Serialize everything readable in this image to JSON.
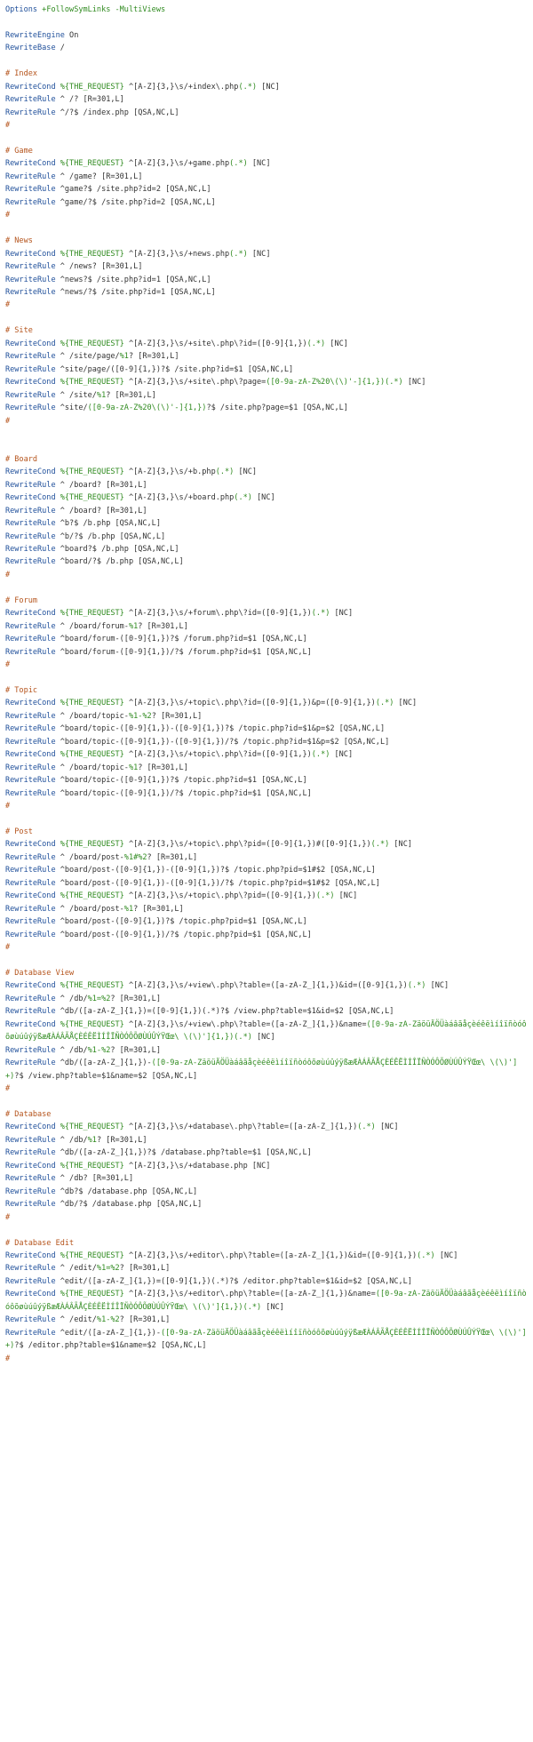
{
  "document": {
    "lines": [
      [
        [
          "kw",
          "Options"
        ],
        [
          "vr",
          " +FollowSymLinks -MultiViews"
        ]
      ],
      [],
      [
        [
          "kw",
          "RewriteEngine"
        ],
        [
          "fl",
          " On"
        ]
      ],
      [
        [
          "kw",
          "RewriteBase"
        ],
        [
          "fl",
          " /"
        ]
      ],
      [],
      [
        [
          "cm",
          "# Index"
        ]
      ],
      [
        [
          "kw",
          "RewriteCond"
        ],
        [
          "vr",
          " %{THE_REQUEST}"
        ],
        [
          "fl",
          " ^[A-Z]{3,}\\s/+index\\.php"
        ],
        [
          "vr",
          "(.*)"
        ],
        [
          "fl",
          " [NC]"
        ]
      ],
      [
        [
          "kw",
          "RewriteRule"
        ],
        [
          "fl",
          " ^ /? [R=301,L]"
        ]
      ],
      [
        [
          "kw",
          "RewriteRule"
        ],
        [
          "fl",
          " ^/?$ /index.php [QSA,NC,L]"
        ]
      ],
      [
        [
          "cm",
          "#"
        ]
      ],
      [],
      [
        [
          "cm",
          "# Game"
        ]
      ],
      [
        [
          "kw",
          "RewriteCond"
        ],
        [
          "vr",
          " %{THE_REQUEST}"
        ],
        [
          "fl",
          " ^[A-Z]{3,}\\s/+game.php"
        ],
        [
          "vr",
          "(.*)"
        ],
        [
          "fl",
          " [NC]"
        ]
      ],
      [
        [
          "kw",
          "RewriteRule"
        ],
        [
          "fl",
          " ^ /game? [R=301,L]"
        ]
      ],
      [
        [
          "kw",
          "RewriteRule"
        ],
        [
          "fl",
          " ^game?$ /site.php?id=2 [QSA,NC,L]"
        ]
      ],
      [
        [
          "kw",
          "RewriteRule"
        ],
        [
          "fl",
          " ^game/?$ /site.php?id=2 [QSA,NC,L]"
        ]
      ],
      [
        [
          "cm",
          "#"
        ]
      ],
      [],
      [
        [
          "cm",
          "# News"
        ]
      ],
      [
        [
          "kw",
          "RewriteCond"
        ],
        [
          "vr",
          " %{THE_REQUEST}"
        ],
        [
          "fl",
          " ^[A-Z]{3,}\\s/+news.php"
        ],
        [
          "vr",
          "(.*)"
        ],
        [
          "fl",
          " [NC]"
        ]
      ],
      [
        [
          "kw",
          "RewriteRule"
        ],
        [
          "fl",
          " ^ /news? [R=301,L]"
        ]
      ],
      [
        [
          "kw",
          "RewriteRule"
        ],
        [
          "fl",
          " ^news?$ /site.php?id=1 [QSA,NC,L]"
        ]
      ],
      [
        [
          "kw",
          "RewriteRule"
        ],
        [
          "fl",
          " ^news/?$ /site.php?id=1 [QSA,NC,L]"
        ]
      ],
      [
        [
          "cm",
          "#"
        ]
      ],
      [],
      [
        [
          "cm",
          "# Site"
        ]
      ],
      [
        [
          "kw",
          "RewriteCond"
        ],
        [
          "vr",
          " %{THE_REQUEST}"
        ],
        [
          "fl",
          " ^[A-Z]{3,}\\s/+site\\.php\\?id=([0-9]{1,})"
        ],
        [
          "vr",
          "(.*)"
        ],
        [
          "fl",
          " [NC]"
        ]
      ],
      [
        [
          "kw",
          "RewriteRule"
        ],
        [
          "fl",
          " ^ /site/page/"
        ],
        [
          "vr",
          "%1"
        ],
        [
          "fl",
          "? [R=301,L]"
        ]
      ],
      [
        [
          "kw",
          "RewriteRule"
        ],
        [
          "fl",
          " ^site/page/([0-9]{1,})?$ /site.php?id=$1 [QSA,NC,L]"
        ]
      ],
      [
        [
          "kw",
          "RewriteCond"
        ],
        [
          "vr",
          " %{THE_REQUEST}"
        ],
        [
          "fl",
          " ^[A-Z]{3,}\\s/+site\\.php\\?page="
        ],
        [
          "vr",
          "([0-9a-zA-Z%20\\(\\)'-]{1,})(.*)"
        ],
        [
          "fl",
          " [NC]"
        ]
      ],
      [
        [
          "kw",
          "RewriteRule"
        ],
        [
          "fl",
          " ^ /site/"
        ],
        [
          "vr",
          "%1"
        ],
        [
          "fl",
          "? [R=301,L]"
        ]
      ],
      [
        [
          "kw",
          "RewriteRule"
        ],
        [
          "fl",
          " ^site/"
        ],
        [
          "vr",
          "([0-9a-zA-Z%20\\(\\)'-]{1,})"
        ],
        [
          "fl",
          "?$ /site.php?page=$1 [QSA,NC,L]"
        ]
      ],
      [
        [
          "cm",
          "#"
        ]
      ],
      [],
      [],
      [
        [
          "cm",
          "# Board"
        ]
      ],
      [
        [
          "kw",
          "RewriteCond"
        ],
        [
          "vr",
          " %{THE_REQUEST}"
        ],
        [
          "fl",
          " ^[A-Z]{3,}\\s/+b.php"
        ],
        [
          "vr",
          "(.*)"
        ],
        [
          "fl",
          " [NC]"
        ]
      ],
      [
        [
          "kw",
          "RewriteRule"
        ],
        [
          "fl",
          " ^ /board? [R=301,L]"
        ]
      ],
      [
        [
          "kw",
          "RewriteCond"
        ],
        [
          "vr",
          " %{THE_REQUEST}"
        ],
        [
          "fl",
          " ^[A-Z]{3,}\\s/+board.php"
        ],
        [
          "vr",
          "(.*)"
        ],
        [
          "fl",
          " [NC]"
        ]
      ],
      [
        [
          "kw",
          "RewriteRule"
        ],
        [
          "fl",
          " ^ /board? [R=301,L]"
        ]
      ],
      [
        [
          "kw",
          "RewriteRule"
        ],
        [
          "fl",
          " ^b?$ /b.php [QSA,NC,L]"
        ]
      ],
      [
        [
          "kw",
          "RewriteRule"
        ],
        [
          "fl",
          " ^b/?$ /b.php [QSA,NC,L]"
        ]
      ],
      [
        [
          "kw",
          "RewriteRule"
        ],
        [
          "fl",
          " ^board?$ /b.php [QSA,NC,L]"
        ]
      ],
      [
        [
          "kw",
          "RewriteRule"
        ],
        [
          "fl",
          " ^board/?$ /b.php [QSA,NC,L]"
        ]
      ],
      [
        [
          "cm",
          "#"
        ]
      ],
      [],
      [
        [
          "cm",
          "# Forum"
        ]
      ],
      [
        [
          "kw",
          "RewriteCond"
        ],
        [
          "vr",
          " %{THE_REQUEST}"
        ],
        [
          "fl",
          " ^[A-Z]{3,}\\s/+forum\\.php\\?id=([0-9]{1,})"
        ],
        [
          "vr",
          "(.*)"
        ],
        [
          "fl",
          " [NC]"
        ]
      ],
      [
        [
          "kw",
          "RewriteRule"
        ],
        [
          "fl",
          " ^ /board/forum-"
        ],
        [
          "vr",
          "%1"
        ],
        [
          "fl",
          "? [R=301,L]"
        ]
      ],
      [
        [
          "kw",
          "RewriteRule"
        ],
        [
          "fl",
          " ^board/forum-([0-9]{1,})?$ /forum.php?id=$1 [QSA,NC,L]"
        ]
      ],
      [
        [
          "kw",
          "RewriteRule"
        ],
        [
          "fl",
          " ^board/forum-([0-9]{1,})/?$ /forum.php?id=$1 [QSA,NC,L]"
        ]
      ],
      [
        [
          "cm",
          "#"
        ]
      ],
      [],
      [
        [
          "cm",
          "# Topic"
        ]
      ],
      [
        [
          "kw",
          "RewriteCond"
        ],
        [
          "vr",
          " %{THE_REQUEST}"
        ],
        [
          "fl",
          " ^[A-Z]{3,}\\s/+topic\\.php\\?id=([0-9]{1,})&p=([0-9]{1,})"
        ],
        [
          "vr",
          "(.*)"
        ],
        [
          "fl",
          " [NC]"
        ]
      ],
      [
        [
          "kw",
          "RewriteRule"
        ],
        [
          "fl",
          " ^ /board/topic-"
        ],
        [
          "vr",
          "%1-%2"
        ],
        [
          "fl",
          "? [R=301,L]"
        ]
      ],
      [
        [
          "kw",
          "RewriteRule"
        ],
        [
          "fl",
          " ^board/topic-([0-9]{1,})-([0-9]{1,})?$ /topic.php?id=$1&p=$2 [QSA,NC,L]"
        ]
      ],
      [
        [
          "kw",
          "RewriteRule"
        ],
        [
          "fl",
          " ^board/topic-([0-9]{1,})-([0-9]{1,})/?$ /topic.php?id=$1&p=$2 [QSA,NC,L]"
        ]
      ],
      [
        [
          "kw",
          "RewriteCond"
        ],
        [
          "vr",
          " %{THE_REQUEST}"
        ],
        [
          "fl",
          " ^[A-Z]{3,}\\s/+topic\\.php\\?id=([0-9]{1,})"
        ],
        [
          "vr",
          "(.*)"
        ],
        [
          "fl",
          " [NC]"
        ]
      ],
      [
        [
          "kw",
          "RewriteRule"
        ],
        [
          "fl",
          " ^ /board/topic-"
        ],
        [
          "vr",
          "%1"
        ],
        [
          "fl",
          "? [R=301,L]"
        ]
      ],
      [
        [
          "kw",
          "RewriteRule"
        ],
        [
          "fl",
          " ^board/topic-([0-9]{1,})?$ /topic.php?id=$1 [QSA,NC,L]"
        ]
      ],
      [
        [
          "kw",
          "RewriteRule"
        ],
        [
          "fl",
          " ^board/topic-([0-9]{1,})/?$ /topic.php?id=$1 [QSA,NC,L]"
        ]
      ],
      [
        [
          "cm",
          "#"
        ]
      ],
      [],
      [
        [
          "cm",
          "# Post"
        ]
      ],
      [
        [
          "kw",
          "RewriteCond"
        ],
        [
          "vr",
          " %{THE_REQUEST}"
        ],
        [
          "fl",
          " ^[A-Z]{3,}\\s/+topic\\.php\\?pid=([0-9]{1,})#([0-9]{1,})"
        ],
        [
          "vr",
          "(.*)"
        ],
        [
          "fl",
          " [NC]"
        ]
      ],
      [
        [
          "kw",
          "RewriteRule"
        ],
        [
          "fl",
          " ^ /board/post-"
        ],
        [
          "vr",
          "%1#%2"
        ],
        [
          "fl",
          "? [R=301,L]"
        ]
      ],
      [
        [
          "kw",
          "RewriteRule"
        ],
        [
          "fl",
          " ^board/post-([0-9]{1,})-([0-9]{1,})?$ /topic.php?pid=$1#$2 [QSA,NC,L]"
        ]
      ],
      [
        [
          "kw",
          "RewriteRule"
        ],
        [
          "fl",
          " ^board/post-([0-9]{1,})-([0-9]{1,})/?$ /topic.php?pid=$1#$2 [QSA,NC,L]"
        ]
      ],
      [
        [
          "kw",
          "RewriteCond"
        ],
        [
          "vr",
          " %{THE_REQUEST}"
        ],
        [
          "fl",
          " ^[A-Z]{3,}\\s/+topic\\.php\\?pid=([0-9]{1,})"
        ],
        [
          "vr",
          "(.*)"
        ],
        [
          "fl",
          " [NC]"
        ]
      ],
      [
        [
          "kw",
          "RewriteRule"
        ],
        [
          "fl",
          " ^ /board/post-"
        ],
        [
          "vr",
          "%1"
        ],
        [
          "fl",
          "? [R=301,L]"
        ]
      ],
      [
        [
          "kw",
          "RewriteRule"
        ],
        [
          "fl",
          " ^board/post-([0-9]{1,})?$ /topic.php?pid=$1 [QSA,NC,L]"
        ]
      ],
      [
        [
          "kw",
          "RewriteRule"
        ],
        [
          "fl",
          " ^board/post-([0-9]{1,})/?$ /topic.php?pid=$1 [QSA,NC,L]"
        ]
      ],
      [
        [
          "cm",
          "#"
        ]
      ],
      [],
      [
        [
          "cm",
          "# Database View"
        ]
      ],
      [
        [
          "kw",
          "RewriteCond"
        ],
        [
          "vr",
          " %{THE_REQUEST}"
        ],
        [
          "fl",
          " ^[A-Z]{3,}\\s/+view\\.php\\?table=([a-zA-Z_]{1,})&id=([0-9]{1,})"
        ],
        [
          "vr",
          "(.*)"
        ],
        [
          "fl",
          " [NC]"
        ]
      ],
      [
        [
          "kw",
          "RewriteRule"
        ],
        [
          "fl",
          " ^ /db/"
        ],
        [
          "vr",
          "%1=%2"
        ],
        [
          "fl",
          "? [R=301,L]"
        ]
      ],
      [
        [
          "kw",
          "RewriteRule"
        ],
        [
          "fl",
          " ^db/([a-zA-Z_]{1,})=([0-9]{1,})(.*)?$ /view.php?table=$1&id=$2 [QSA,NC,L]"
        ]
      ],
      [
        [
          "kw",
          "RewriteCond"
        ],
        [
          "vr",
          " %{THE_REQUEST}"
        ],
        [
          "fl",
          " ^[A-Z]{3,}\\s/+view\\.php\\?table=([a-zA-Z_]{1,})&name="
        ],
        [
          "vr",
          "([0-9a-zA-ZäöüÄÖÜàáâãåçèéêëìíîïñòóôõøùúûýÿßæÆÀÁÂÃÅÇÈÉÊËÌÍÎÏÑÒÓÔÕØÙÚÛÝŸŒœ\\ \\(\\)']{1,})(.*)"
        ],
        [
          "fl",
          " [NC]"
        ]
      ],
      [
        [
          "kw",
          "RewriteRule"
        ],
        [
          "fl",
          " ^ /db/"
        ],
        [
          "vr",
          "%1-%2"
        ],
        [
          "fl",
          "? [R=301,L]"
        ]
      ],
      [
        [
          "kw",
          "RewriteRule"
        ],
        [
          "fl",
          " ^db/([a-zA-Z_]{1,})-"
        ],
        [
          "vr",
          "([0-9a-zA-ZäöüÄÖÜàáâãåçèéêëìíîïñòóôõøùúûýÿßæÆÀÁÂÃÅÇÈÉÊËÌÍÎÏÑÒÓÔÕØÙÚÛÝŸŒœ\\ \\(\\)']+)"
        ],
        [
          "fl",
          "?$ /view.php?table=$1&name=$2 [QSA,NC,L]"
        ]
      ],
      [
        [
          "cm",
          "#"
        ]
      ],
      [],
      [
        [
          "cm",
          "# Database"
        ]
      ],
      [
        [
          "kw",
          "RewriteCond"
        ],
        [
          "vr",
          " %{THE_REQUEST}"
        ],
        [
          "fl",
          " ^[A-Z]{3,}\\s/+database\\.php\\?table=([a-zA-Z_]{1,})"
        ],
        [
          "vr",
          "(.*)"
        ],
        [
          "fl",
          " [NC]"
        ]
      ],
      [
        [
          "kw",
          "RewriteRule"
        ],
        [
          "fl",
          " ^ /db/"
        ],
        [
          "vr",
          "%1"
        ],
        [
          "fl",
          "? [R=301,L]"
        ]
      ],
      [
        [
          "kw",
          "RewriteRule"
        ],
        [
          "fl",
          " ^db/([a-zA-Z_]{1,})?$ /database.php?table=$1 [QSA,NC,L]"
        ]
      ],
      [
        [
          "kw",
          "RewriteCond"
        ],
        [
          "vr",
          " %{THE_REQUEST}"
        ],
        [
          "fl",
          " ^[A-Z]{3,}\\s/+database.php [NC]"
        ]
      ],
      [
        [
          "kw",
          "RewriteRule"
        ],
        [
          "fl",
          " ^ /db? [R=301,L]"
        ]
      ],
      [
        [
          "kw",
          "RewriteRule"
        ],
        [
          "fl",
          " ^db?$ /database.php [QSA,NC,L]"
        ]
      ],
      [
        [
          "kw",
          "RewriteRule"
        ],
        [
          "fl",
          " ^db/?$ /database.php [QSA,NC,L]"
        ]
      ],
      [
        [
          "cm",
          "#"
        ]
      ],
      [],
      [
        [
          "cm",
          "# Database Edit"
        ]
      ],
      [
        [
          "kw",
          "RewriteCond"
        ],
        [
          "vr",
          " %{THE_REQUEST}"
        ],
        [
          "fl",
          " ^[A-Z]{3,}\\s/+editor\\.php\\?table=([a-zA-Z_]{1,})&id=([0-9]{1,})"
        ],
        [
          "vr",
          "(.*)"
        ],
        [
          "fl",
          " [NC]"
        ]
      ],
      [
        [
          "kw",
          "RewriteRule"
        ],
        [
          "fl",
          " ^ /edit/"
        ],
        [
          "vr",
          "%1=%2"
        ],
        [
          "fl",
          "? [R=301,L]"
        ]
      ],
      [
        [
          "kw",
          "RewriteRule"
        ],
        [
          "fl",
          " ^edit/([a-zA-Z_]{1,})=([0-9]{1,})(.*)?$ /editor.php?table=$1&id=$2 [QSA,NC,L]"
        ]
      ],
      [
        [
          "kw",
          "RewriteCond"
        ],
        [
          "vr",
          " %{THE_REQUEST}"
        ],
        [
          "fl",
          " ^[A-Z]{3,}\\s/+editor\\.php\\?table=([a-zA-Z_]{1,})&name="
        ],
        [
          "vr",
          "([0-9a-zA-ZäöüÄÖÜàáâãåçèéêëìíîïñòóôõøùúûýÿßæÆÀÁÂÃÅÇÈÉÊËÌÍÎÏÑÒÓÔÕØÙÚÛÝŸŒœ\\ \\(\\)']{1,})(.*)"
        ],
        [
          "fl",
          " [NC]"
        ]
      ],
      [
        [
          "kw",
          "RewriteRule"
        ],
        [
          "fl",
          " ^ /edit/"
        ],
        [
          "vr",
          "%1-%2"
        ],
        [
          "fl",
          "? [R=301,L]"
        ]
      ],
      [
        [
          "kw",
          "RewriteRule"
        ],
        [
          "fl",
          " ^edit/([a-zA-Z_]{1,})-"
        ],
        [
          "vr",
          "([0-9a-zA-ZäöüÄÖÜàáâãåçèéêëìíîïñòóôõøùúûýÿßæÆÀÁÂÃÅÇÈÉÊËÌÍÎÏÑÒÓÔÕØÙÚÛÝŸŒœ\\ \\(\\)']+)"
        ],
        [
          "fl",
          "?$ /editor.php?table=$1&name=$2 [QSA,NC,L]"
        ]
      ],
      [
        [
          "cm",
          "#"
        ]
      ]
    ]
  },
  "colors": {
    "directive": "#1f4f9a",
    "comment": "#b5541c",
    "variable": "#2f8a1f",
    "text": "#333333",
    "background": "#ffffff"
  }
}
